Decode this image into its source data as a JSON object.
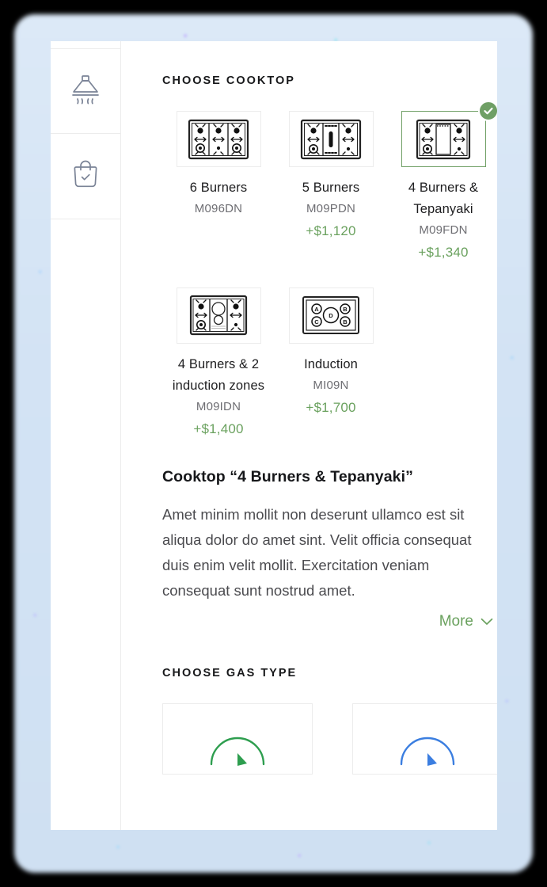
{
  "sidebar": {
    "items": [
      {
        "name": "range-hood",
        "icon": "range-hood-icon"
      },
      {
        "name": "shopping-bag-checked",
        "icon": "shopping-bag-check-icon"
      }
    ]
  },
  "cooktop_section": {
    "title": "CHOOSE COOKTOP",
    "options": [
      {
        "name": "6 Burners",
        "sku": "M096DN",
        "price": "",
        "selected": false,
        "icon": "cooktop-6-burners-icon"
      },
      {
        "name": "5 Burners",
        "sku": "M09PDN",
        "price": "+$1,120",
        "selected": false,
        "icon": "cooktop-5-burners-icon"
      },
      {
        "name": "4 Burners & Tepanyaki",
        "sku": "M09FDN",
        "price": "+$1,340",
        "selected": true,
        "icon": "cooktop-tepanyaki-icon"
      },
      {
        "name": "4 Burners & 2 induction zones",
        "sku": "M09IDN",
        "price": "+$1,400",
        "selected": false,
        "icon": "cooktop-4burners-2induction-icon"
      },
      {
        "name": "Induction",
        "sku": "MI09N",
        "price": "+$1,700",
        "selected": false,
        "icon": "cooktop-induction-icon"
      }
    ]
  },
  "description": {
    "title": "Cooktop “4 Burners & Tepanyaki”",
    "body": "Amet minim mollit non deserunt ullamco est sit aliqua dolor do amet sint. Velit officia consequat duis enim velit mollit. Exercitation veniam consequat sunt nostrud amet.",
    "more_label": "More"
  },
  "gas_section": {
    "title": "CHOOSE GAS TYPE",
    "options": [
      {
        "name": "natural-gas",
        "accent": "#2e9e4f"
      },
      {
        "name": "lpg-gas",
        "accent": "#3b7ee0"
      }
    ]
  },
  "induction_zone_labels": [
    "A",
    "B",
    "C",
    "D",
    "B"
  ],
  "colors": {
    "accent_green": "#6aa15e",
    "badge_green": "#6f9f65",
    "text_dark": "#1d1d1f",
    "text_muted": "#6e6e73",
    "border": "#ececec"
  }
}
